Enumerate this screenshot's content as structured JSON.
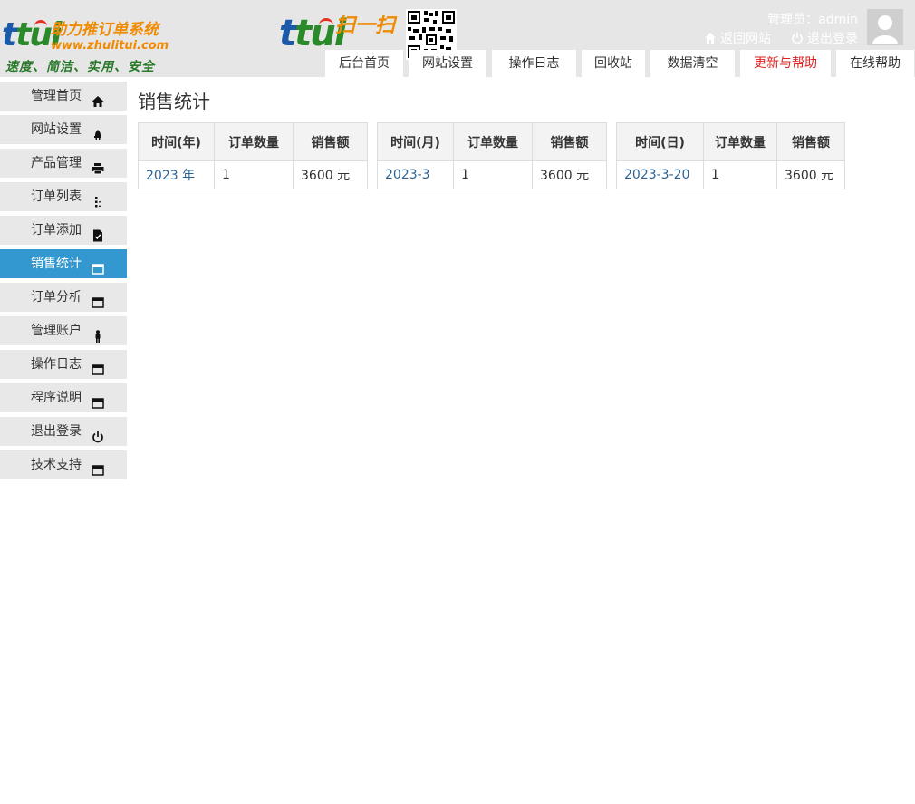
{
  "header": {
    "logo": {
      "brand_left": "tui",
      "name": "助力推订单系统",
      "url": "www.zhulitui.com",
      "slogan": "速度、简洁、实用、安全"
    },
    "scan": {
      "brand": "tui",
      "text": "扫一扫"
    },
    "admin_label": "管理员：admin",
    "links": {
      "return_site": "返回网站",
      "logout": "退出登录"
    }
  },
  "nav": {
    "tabs": [
      {
        "label": "后台首页",
        "color": "#333333"
      },
      {
        "label": "网站设置",
        "color": "#333333"
      },
      {
        "label": "操作日志",
        "color": "#333333"
      },
      {
        "label": "回收站",
        "color": "#333333"
      },
      {
        "label": "数据清空",
        "color": "#333333"
      },
      {
        "label": "更新与帮助",
        "color": "#e02020"
      },
      {
        "label": "在线帮助",
        "color": "#333333"
      }
    ]
  },
  "sidebar": {
    "items": [
      {
        "label": "管理首页",
        "icon": "home-icon"
      },
      {
        "label": "网站设置",
        "icon": "plug-icon"
      },
      {
        "label": "产品管理",
        "icon": "printer-icon"
      },
      {
        "label": "订单列表",
        "icon": "list-icon"
      },
      {
        "label": "订单添加",
        "icon": "document-check-icon"
      },
      {
        "label": "销售统计",
        "icon": "window-icon",
        "active": true
      },
      {
        "label": "订单分析",
        "icon": "window-icon"
      },
      {
        "label": "管理账户",
        "icon": "person-icon"
      },
      {
        "label": "操作日志",
        "icon": "window-icon"
      },
      {
        "label": "程序说明",
        "icon": "window-icon"
      },
      {
        "label": "退出登录",
        "icon": "power-icon"
      },
      {
        "label": "技术支持",
        "icon": "window-icon"
      }
    ]
  },
  "main": {
    "title": "销售统计",
    "tables": [
      {
        "headers": [
          "时间(年)",
          "订单数量",
          "销售额"
        ],
        "rows": [
          [
            "2023 年",
            "1",
            "3600 元"
          ]
        ]
      },
      {
        "headers": [
          "时间(月)",
          "订单数量",
          "销售额"
        ],
        "rows": [
          [
            "2023-3",
            "1",
            "3600 元"
          ]
        ]
      },
      {
        "headers": [
          "时间(日)",
          "订单数量",
          "销售额"
        ],
        "rows": [
          [
            "2023-3-20",
            "1",
            "3600 元"
          ]
        ]
      }
    ]
  },
  "colors": {
    "accent": "#3498d0",
    "header_bg": "#e6e6e6",
    "link": "#2a6496",
    "highlight_tab": "#e02020"
  }
}
